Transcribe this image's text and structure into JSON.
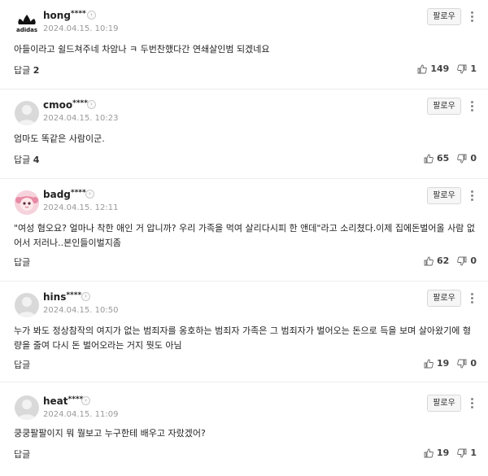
{
  "follow_label": "팔로우",
  "reply_label": "답글",
  "comments": [
    {
      "user": "hong",
      "mask": "****",
      "date": "2024.04.15. 10:19",
      "text": "아들이라고 쉴드쳐주네 차암나 ㅋ 두번찬했다간 연쇄살인범 되겠네요",
      "reply_count": "2",
      "likes": "149",
      "dislikes": "1",
      "avatar": "adidas-logo"
    },
    {
      "user": "cmoo",
      "mask": "****",
      "date": "2024.04.15. 10:23",
      "text": "엄마도 똑같은 사람이군.",
      "reply_count": "4",
      "likes": "65",
      "dislikes": "0",
      "avatar": "default-avatar"
    },
    {
      "user": "badg",
      "mask": "****",
      "date": "2024.04.15. 12:11",
      "text": "\"여성 혐오요? 얼마나 착한 애인 거 압니까? 우리 가족을 먹여 살리다시피 한 앤데\"라고 소리쳤다.이제 집에돈벌어올 사람 없어서 저러나..본인들이벌지좀",
      "reply_count": "",
      "likes": "62",
      "dislikes": "0",
      "avatar": "character-avatar"
    },
    {
      "user": "hins",
      "mask": "****",
      "date": "2024.04.15. 10:50",
      "text": "누가 봐도 정상참작의 여지가 없는 범죄자를 옹호하는 범죄자 가족은 그 범죄자가 벌어오는 돈으로 득을 보며 살아왔기에 형량을 줄여 다시 돈 벌어오라는 거지 뭣도 아님",
      "reply_count": "",
      "likes": "19",
      "dislikes": "0",
      "avatar": "default-avatar"
    },
    {
      "user": "heat",
      "mask": "****",
      "date": "2024.04.15. 11:09",
      "text": "쿵쿵팔팔이지 뭐 뭘보고 누구한테 배우고 자랐겠어?",
      "reply_count": "",
      "likes": "19",
      "dislikes": "1",
      "avatar": "default-avatar"
    }
  ]
}
